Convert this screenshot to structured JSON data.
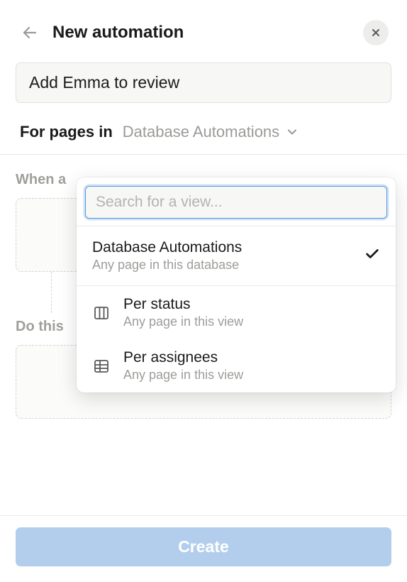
{
  "header": {
    "title": "New automation"
  },
  "nameInput": {
    "value": "Add Emma to review"
  },
  "forPages": {
    "label": "For pages in",
    "selected": "Database Automations"
  },
  "sections": {
    "whenLabel": "When a",
    "doThisLabel": "Do this"
  },
  "dropdown": {
    "searchPlaceholder": "Search for a view...",
    "options": [
      {
        "title": "Database Automations",
        "subtitle": "Any page in this database",
        "selected": true,
        "icon": null
      },
      {
        "title": "Per status",
        "subtitle": "Any page in this view",
        "selected": false,
        "icon": "board"
      },
      {
        "title": "Per assignees",
        "subtitle": "Any page in this view",
        "selected": false,
        "icon": "table"
      }
    ]
  },
  "footer": {
    "createLabel": "Create"
  }
}
